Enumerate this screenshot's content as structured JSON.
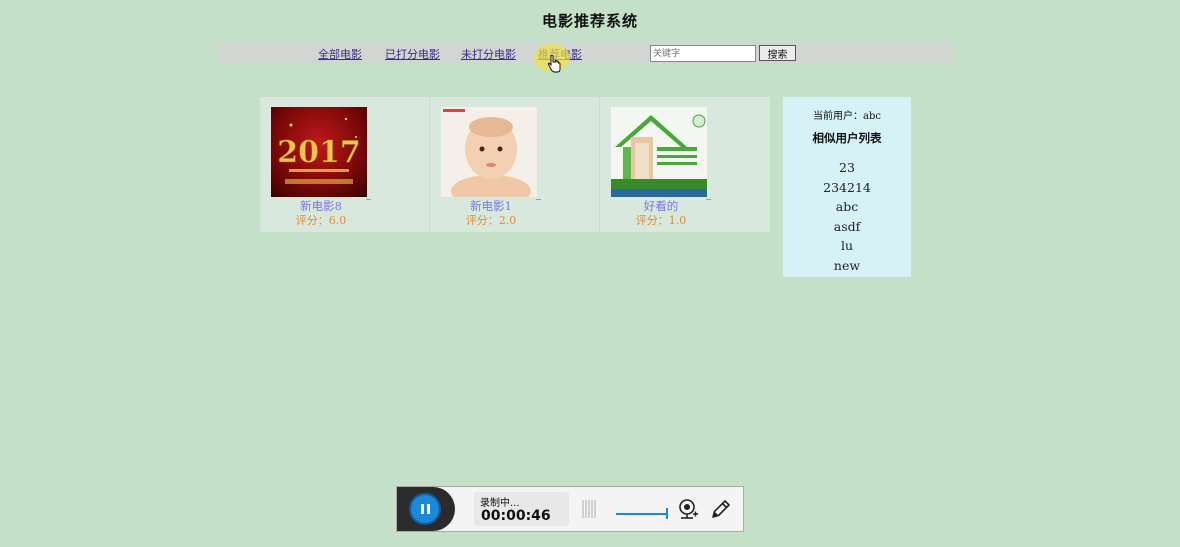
{
  "page": {
    "title": "电影推荐系统"
  },
  "nav": {
    "links": [
      {
        "label": "全部电影"
      },
      {
        "label": "已打分电影"
      },
      {
        "label": "未打分电影"
      },
      {
        "label": "推荐电影"
      }
    ],
    "search_placeholder": "关键字",
    "search_button": "搜索"
  },
  "movies": [
    {
      "name": "新电影8",
      "score": "评分：6.0",
      "poster_text": "2017"
    },
    {
      "name": "新电影1",
      "score": "评分：2.0"
    },
    {
      "name": "好看的",
      "score": "评分：1.0"
    }
  ],
  "sidebar": {
    "current_user": "当前用户：abc",
    "similar_title": "相似用户列表",
    "users": [
      "23",
      "234214",
      "abc",
      "asdf",
      "lu",
      "new"
    ]
  },
  "recorder": {
    "status": "录制中...",
    "time": "00:00:46"
  }
}
